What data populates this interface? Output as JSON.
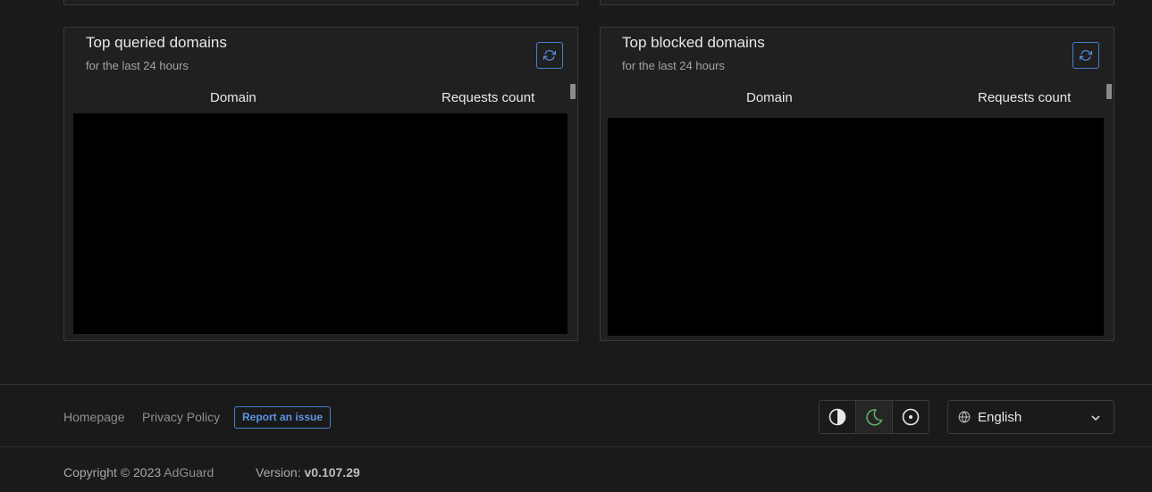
{
  "top_queried": {
    "title": "Top queried domains",
    "subtitle": "for the last 24 hours",
    "col_domain": "Domain",
    "col_count": "Requests count"
  },
  "top_blocked": {
    "title": "Top blocked domains",
    "subtitle": "for the last 24 hours",
    "col_domain": "Domain",
    "col_count": "Requests count"
  },
  "footer": {
    "homepage": "Homepage",
    "privacy": "Privacy Policy",
    "report": "Report an issue",
    "language": "English",
    "copyright_prefix": "Copyright © 2023",
    "brand": "AdGuard",
    "version_label": "Version:",
    "version_value": "v0.107.29"
  },
  "colors": {
    "accent": "#467fcf",
    "active_theme_icon": "#5fae5f",
    "background": "#1a1a1a",
    "card": "#202020"
  },
  "icons": [
    "refresh-icon",
    "contrast-icon",
    "moon-icon",
    "circle-dot-icon",
    "globe-icon",
    "chevron-down-icon"
  ]
}
